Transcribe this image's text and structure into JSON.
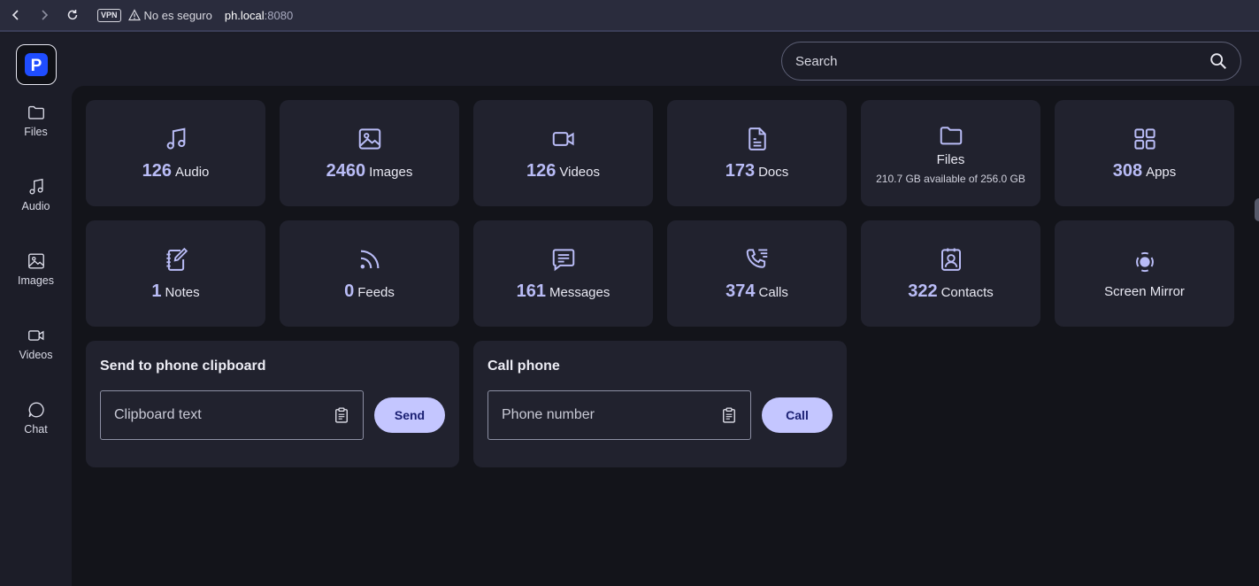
{
  "browser": {
    "vpn": "VPN",
    "security": "No es seguro",
    "url_host": "ph.local",
    "url_port": ":8080"
  },
  "app": {
    "logo": "P",
    "search": {
      "placeholder": "Search"
    }
  },
  "sidebar": {
    "items": [
      {
        "label": "Files",
        "icon": "folder-icon"
      },
      {
        "label": "Audio",
        "icon": "music-icon"
      },
      {
        "label": "Images",
        "icon": "image-icon"
      },
      {
        "label": "Videos",
        "icon": "video-icon"
      },
      {
        "label": "Chat",
        "icon": "chat-icon"
      }
    ]
  },
  "cards": [
    {
      "count": "126",
      "label": "Audio",
      "icon": "music-icon"
    },
    {
      "count": "2460",
      "label": "Images",
      "icon": "image-icon"
    },
    {
      "count": "126",
      "label": "Videos",
      "icon": "video-icon"
    },
    {
      "count": "173",
      "label": "Docs",
      "icon": "document-icon"
    },
    {
      "label": "Files",
      "sub": "210.7 GB available of 256.0 GB",
      "icon": "folder-icon"
    },
    {
      "count": "308",
      "label": "Apps",
      "icon": "apps-grid-icon"
    },
    {
      "count": "1",
      "label": "Notes",
      "icon": "notebook-icon"
    },
    {
      "count": "0",
      "label": "Feeds",
      "icon": "rss-icon"
    },
    {
      "count": "161",
      "label": "Messages",
      "icon": "message-icon"
    },
    {
      "count": "374",
      "label": "Calls",
      "icon": "phone-list-icon"
    },
    {
      "count": "322",
      "label": "Contacts",
      "icon": "contact-icon"
    },
    {
      "label": "Screen Mirror",
      "icon": "screen-mirror-icon"
    }
  ],
  "clipboard": {
    "title": "Send to phone clipboard",
    "placeholder": "Clipboard text",
    "button": "Send"
  },
  "call": {
    "title": "Call phone",
    "placeholder": "Phone number",
    "button": "Call"
  },
  "colors": {
    "accent": "#b9bcf6",
    "button_bg": "#c4c6ff",
    "card_bg": "#21222e",
    "main_bg": "#13141a"
  }
}
